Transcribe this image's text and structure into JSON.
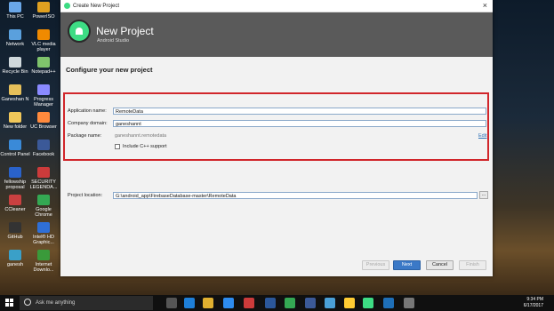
{
  "desktop": {
    "icons": [
      {
        "label": "This PC",
        "color": "#6aa7e8"
      },
      {
        "label": "PowerISO",
        "color": "#e0a020"
      },
      {
        "label": "Network",
        "color": "#5aa0dd"
      },
      {
        "label": "VLC media player",
        "color": "#f08a00"
      },
      {
        "label": "Recycle Bin",
        "color": "#cfd8dc"
      },
      {
        "label": "Notepad++",
        "color": "#7fc36c"
      },
      {
        "label": "Ganeshan N",
        "color": "#e6c05a"
      },
      {
        "label": "Progress Manager",
        "color": "#8a8aff"
      },
      {
        "label": "New folder",
        "color": "#f0c75a"
      },
      {
        "label": "UC Browser",
        "color": "#ff8a3d"
      },
      {
        "label": "Control Panel",
        "color": "#3a8ad8"
      },
      {
        "label": "Facebook",
        "color": "#3b5998"
      },
      {
        "label": "fellowship proposal",
        "color": "#2a62c9"
      },
      {
        "label": "SECURITY LEGENDA...",
        "color": "#cc3b3b"
      },
      {
        "label": "CCleaner",
        "color": "#c94040"
      },
      {
        "label": "Google Chrome",
        "color": "#34a853"
      },
      {
        "label": "GitHub",
        "color": "#333333"
      },
      {
        "label": "Intel® HD Graphic...",
        "color": "#2f6fd6"
      },
      {
        "label": "ganesh",
        "color": "#3aa0c8"
      },
      {
        "label": "Internet Downlo...",
        "color": "#3a9a3a"
      }
    ]
  },
  "window": {
    "title": "Create New Project",
    "close_icon": "×",
    "header_title": "New Project",
    "header_subtitle": "Android Studio",
    "section_title": "Configure your new project",
    "fields": {
      "app_name_label": "Application name:",
      "app_name_value": "RemoteData",
      "company_domain_label": "Company domain:",
      "company_domain_value": "ganeshannt",
      "package_name_label": "Package name:",
      "package_name_value": "ganeshannt.remotedata",
      "edit_link": "Edit",
      "cpp_label": "Include C++ support",
      "project_location_label": "Project location:",
      "project_location_value": "G:\\android_app\\FirebaseDatabase-master\\RemoteData",
      "browse_label": "..."
    },
    "buttons": {
      "previous": "Previous",
      "next": "Next",
      "cancel": "Cancel",
      "finish": "Finish"
    }
  },
  "taskbar": {
    "search_placeholder": "Ask me anything",
    "time": "9:34 PM",
    "date": "6/17/2017"
  },
  "colors": {
    "accent": "#3b79c7",
    "highlight_border": "#d1262b",
    "android_green": "#3ddc84"
  }
}
